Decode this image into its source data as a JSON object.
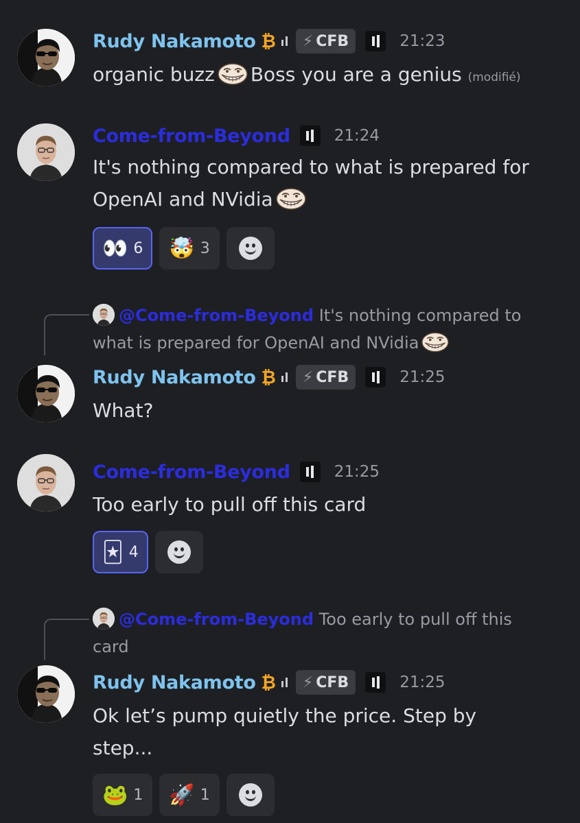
{
  "messages": [
    {
      "author": "Rudy Nakamoto",
      "author_symbol": "₿",
      "tag": "CFB",
      "time": "21:23",
      "text_before": "organic buzz",
      "text_after": "Boss you are a genius",
      "edited": "(modifié)"
    },
    {
      "author": "Come-from-Beyond",
      "time": "21:24",
      "text": "It's nothing compared to what is prepared for OpenAI and NVidia",
      "reactions": [
        {
          "emoji": "👀",
          "count": "6",
          "active": true
        },
        {
          "emoji": "🤯",
          "count": "3",
          "active": false
        }
      ]
    },
    {
      "reply_mention": "@Come-from-Beyond",
      "reply_text": "It's nothing compared to what is prepared for OpenAI and NVidia",
      "author": "Rudy Nakamoto",
      "author_symbol": "₿",
      "tag": "CFB",
      "time": "21:25",
      "text": "What?"
    },
    {
      "author": "Come-from-Beyond",
      "time": "21:25",
      "text": "Too early to pull off this card",
      "reactions": [
        {
          "emoji": "🃏",
          "count": "4",
          "active": true
        }
      ]
    },
    {
      "reply_mention": "@Come-from-Beyond",
      "reply_text": "Too early to pull off this card",
      "author": "Rudy Nakamoto",
      "author_symbol": "₿",
      "tag": "CFB",
      "time": "21:25",
      "text": "Ok let’s pump quietly the price. Step by step...",
      "reactions": [
        {
          "emoji": "🐸",
          "count": "1",
          "active": false
        },
        {
          "emoji": "🚀",
          "count": "1",
          "active": false
        }
      ]
    }
  ],
  "icons": {
    "tag_icon": "lightning-bolt-icon",
    "team_icon": "pause-bars-icon",
    "add_reaction": "smiley-add-reaction-icon"
  },
  "colors": {
    "background": "#1e1f23",
    "rudy_name": "#7ec3ee",
    "cfb_name": "#2b2cdb",
    "bitcoin": "#f5a623",
    "active_reaction_border": "#5865f2"
  }
}
